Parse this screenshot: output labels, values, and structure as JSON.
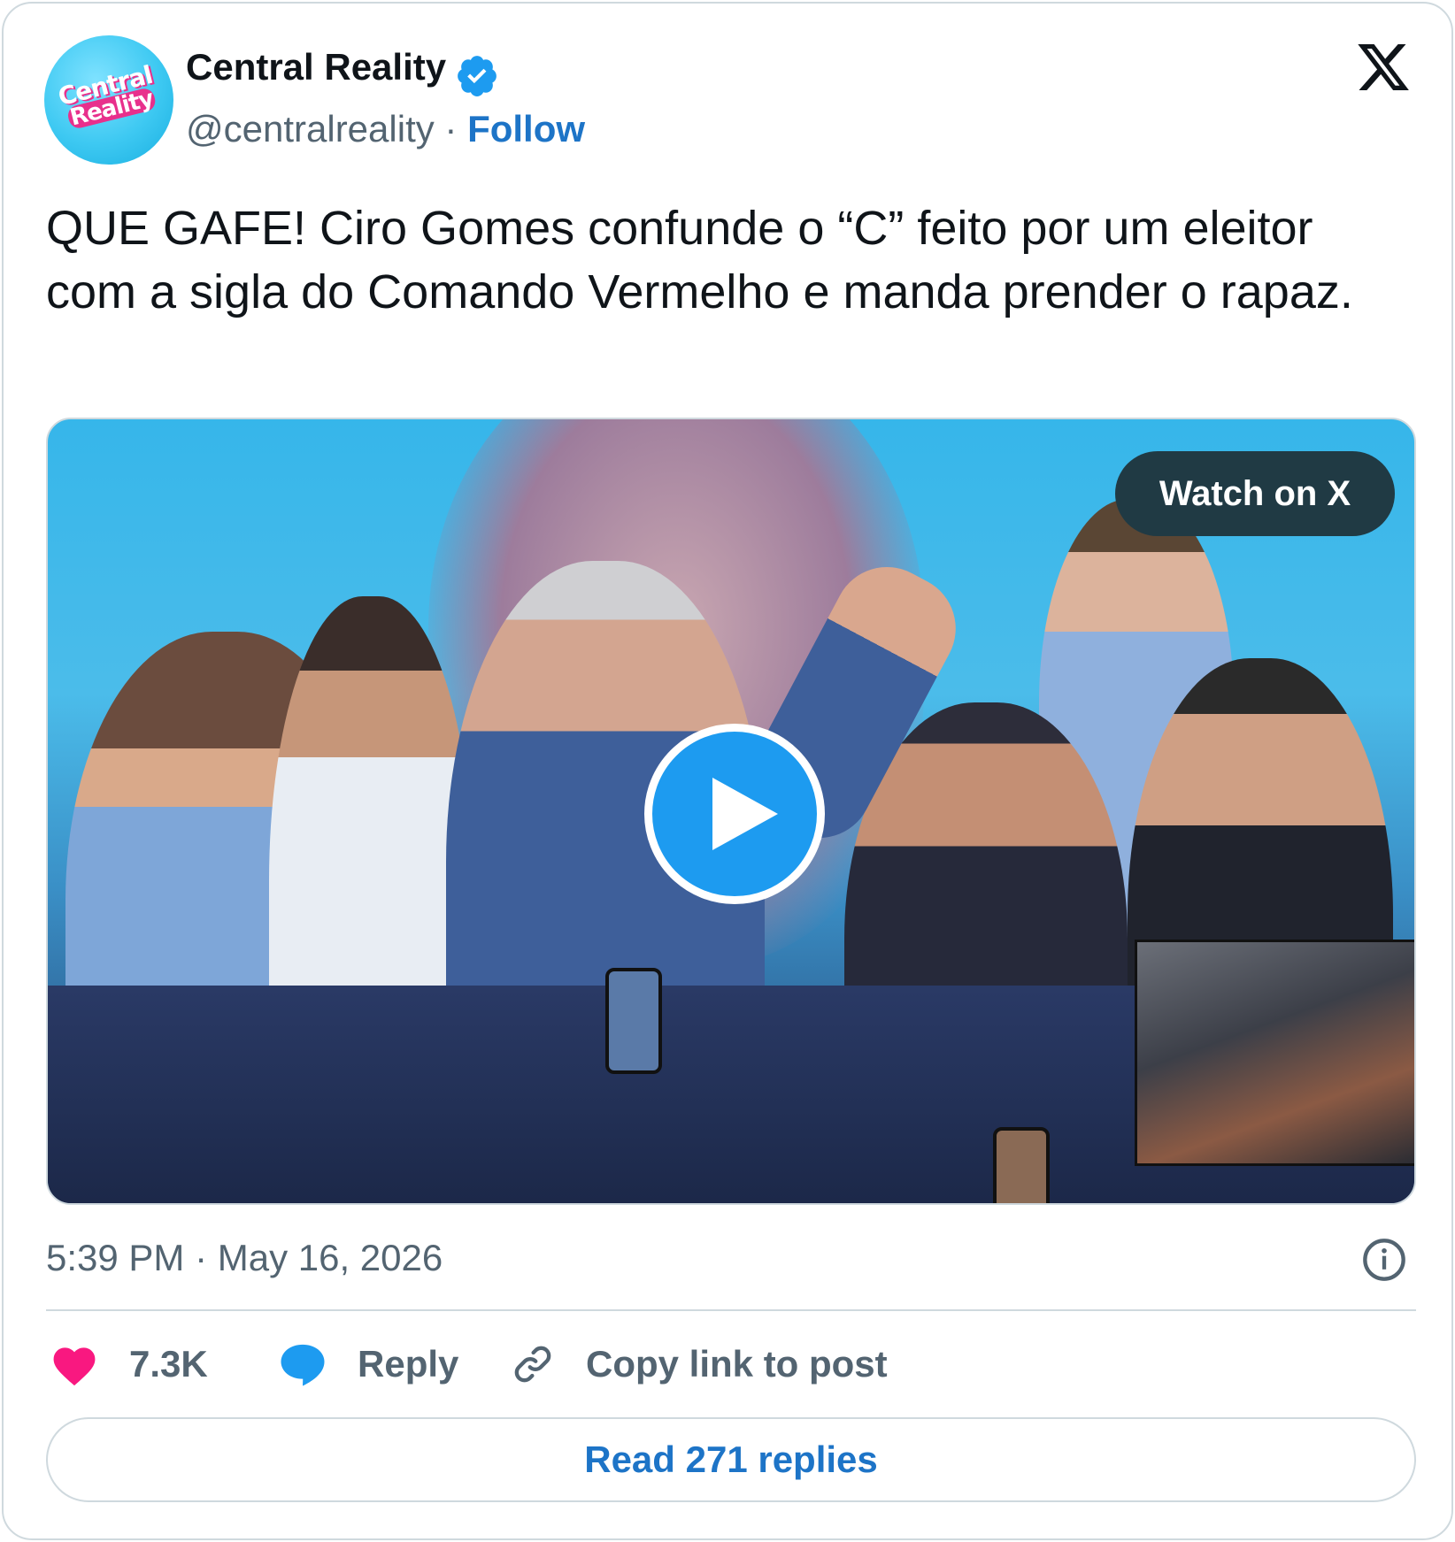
{
  "author": {
    "avatar_logo_line1": "Central",
    "avatar_logo_line2": "Reality",
    "name": "Central Reality",
    "handle": "@centralreality",
    "separator": "·",
    "follow_label": "Follow"
  },
  "tweet": {
    "text": "QUE GAFE! Ciro Gomes confunde o “C” feito por um eleitor com a sigla do Comando Vermelho e manda prender o rapaz."
  },
  "media": {
    "watch_label": "Watch on X",
    "play_icon": "play-icon"
  },
  "meta": {
    "timestamp": "5:39 PM · May 16, 2026",
    "info_icon": "info-icon"
  },
  "actions": {
    "like_count": "7.3K",
    "reply_label": "Reply",
    "copy_label": "Copy link to post"
  },
  "footer": {
    "read_replies_label": "Read 271 replies"
  },
  "colors": {
    "link_blue": "#1d74c7",
    "verified_blue": "#1d9bf0",
    "heart_pink": "#f91880",
    "muted_text": "#536471",
    "watch_button_bg": "#203a44"
  }
}
